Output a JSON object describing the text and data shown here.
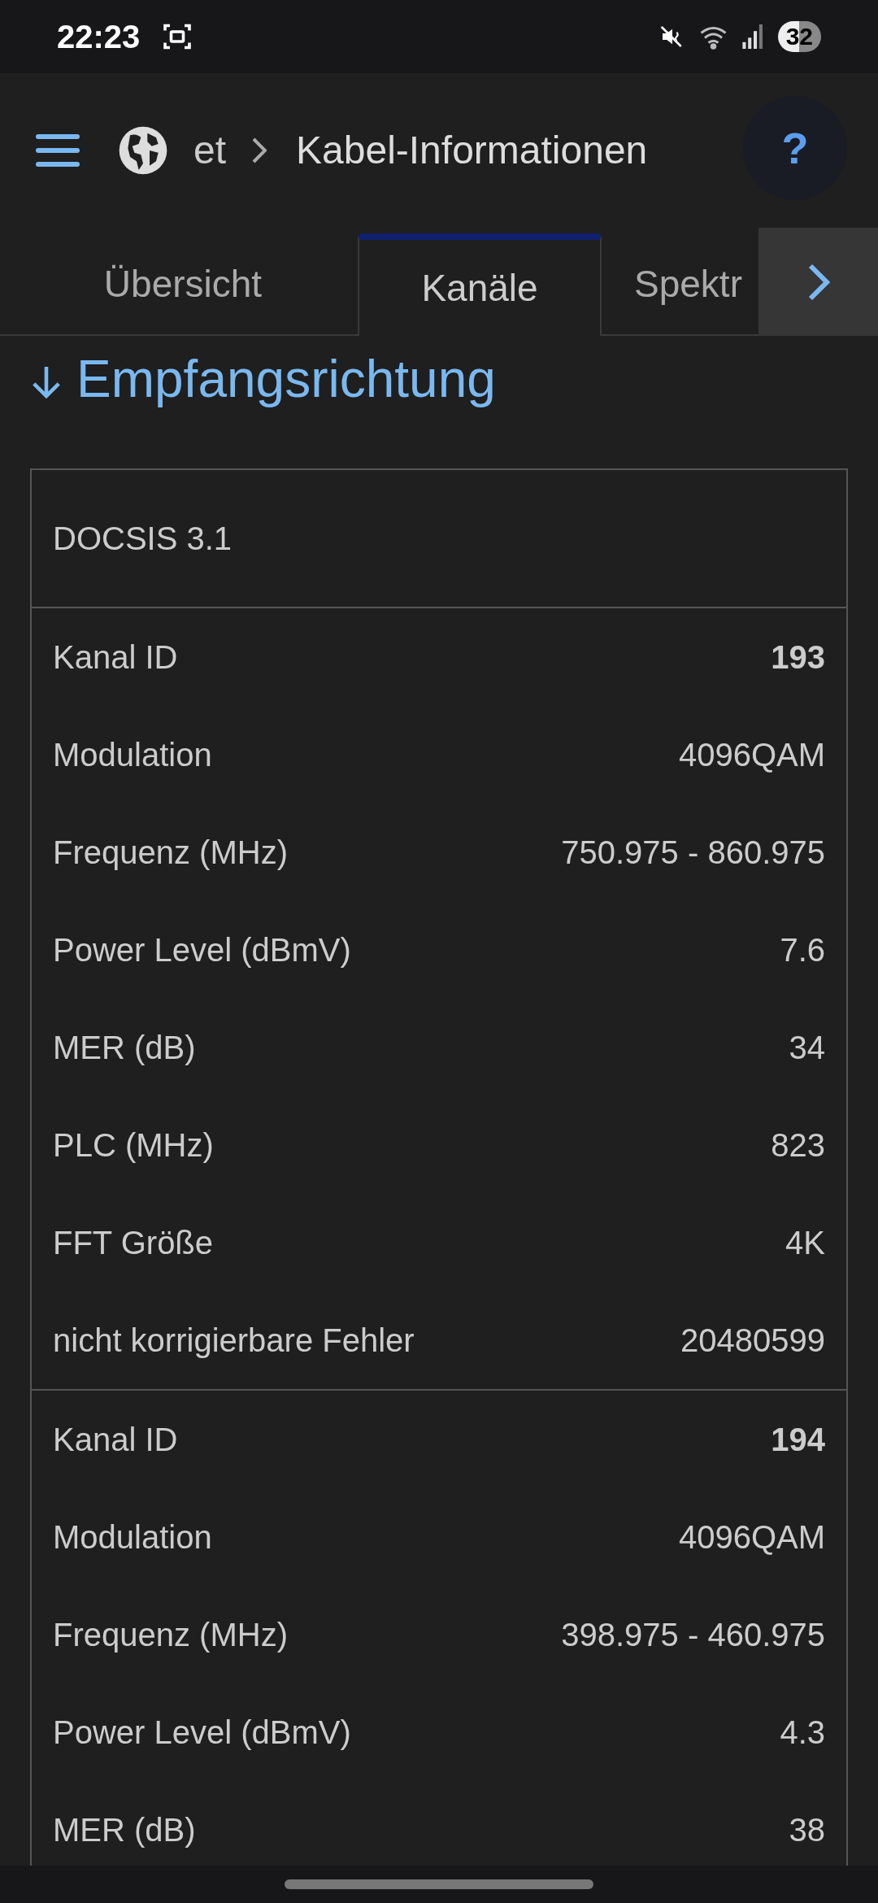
{
  "status_bar": {
    "time": "22:23",
    "battery": "32"
  },
  "header": {
    "breadcrumb": [
      "et",
      "Kabel-Informationen"
    ],
    "help": "?"
  },
  "tabs": [
    {
      "label": "Übersicht",
      "selected": false
    },
    {
      "label": "Kanäle",
      "selected": true
    },
    {
      "label": "Spektr",
      "selected": false
    }
  ],
  "section": {
    "title": "Empfangsrichtung"
  },
  "card": {
    "title": "DOCSIS 3.1",
    "channels": [
      {
        "rows": [
          {
            "kind": "id",
            "label": "Kanal ID",
            "value": "193"
          },
          {
            "kind": "field",
            "label": "Modulation",
            "value": "4096QAM"
          },
          {
            "kind": "field",
            "label": "Frequenz (MHz)",
            "value": "750.975 - 860.975"
          },
          {
            "kind": "field",
            "label": "Power Level (dBmV)",
            "value": "7.6"
          },
          {
            "kind": "field",
            "label": "MER (dB)",
            "value": "34"
          },
          {
            "kind": "field",
            "label": "PLC (MHz)",
            "value": "823"
          },
          {
            "kind": "field",
            "label": "FFT Größe",
            "value": "4K"
          },
          {
            "kind": "field",
            "label": "nicht korrigierbare Fehler",
            "value": "20480599"
          }
        ]
      },
      {
        "rows": [
          {
            "kind": "id",
            "label": "Kanal ID",
            "value": "194"
          },
          {
            "kind": "field",
            "label": "Modulation",
            "value": "4096QAM"
          },
          {
            "kind": "field",
            "label": "Frequenz (MHz)",
            "value": "398.975 - 460.975"
          },
          {
            "kind": "field",
            "label": "Power Level (dBmV)",
            "value": "4.3"
          },
          {
            "kind": "field",
            "label": "MER (dB)",
            "value": "38"
          }
        ]
      }
    ]
  }
}
